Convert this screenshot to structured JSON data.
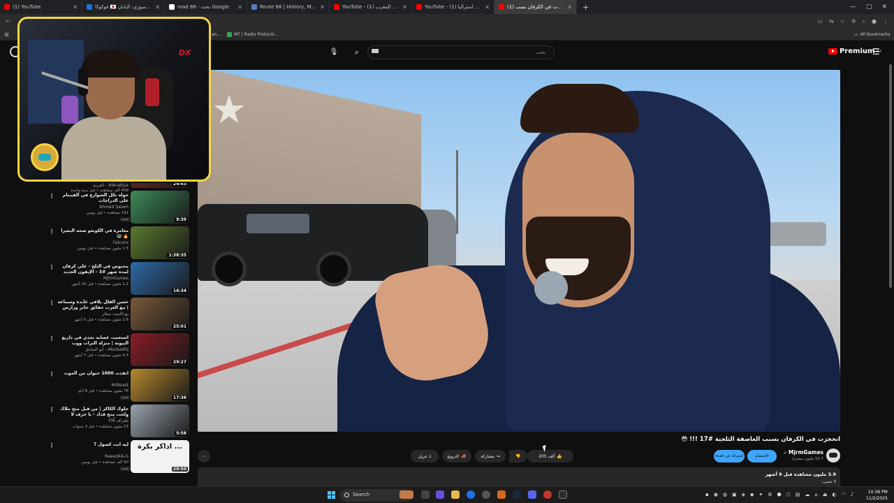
{
  "browser": {
    "tabs": [
      {
        "title": "(1) YouTube",
        "favicon_color": "#ff0000",
        "active": false
      },
      {
        "title": "فوكوكا 🇯🇵 إلى أوسوزي، اليابان",
        "favicon_color": "#1a73e8",
        "active": false
      },
      {
        "title": "road 66 - بحث Google",
        "favicon_color": "#ffffff",
        "active": false
      },
      {
        "title": "Route 66 | History, Map, Popula...",
        "favicon_color": "#5a7cc2",
        "active": false
      },
      {
        "title": "YouTube - (1) كرفان المغرب",
        "favicon_color": "#ff0000",
        "active": false
      },
      {
        "title": "YouTube - (1) كرفان في استراليا",
        "favicon_color": "#ff0000",
        "active": false
      },
      {
        "title": "(1) انحجزت في الكرفان بسب...",
        "favicon_color": "#ff0000",
        "active": true
      }
    ],
    "bookmarks": [
      {
        "label": "an..."
      },
      {
        "label": "MT | Radio Protocol..."
      },
      {
        "label": "All Bookmarks"
      }
    ]
  },
  "youtube": {
    "search_placeholder": "بحث",
    "premium_label": "Premium",
    "region": "SA",
    "menu_glyph": "☰"
  },
  "recommendations": [
    {
      "title": "",
      "channel": "AlArabiya - العربية",
      "meta": "458 ألف مشاهدة • قبل سنة واحدة",
      "duration": "24:43",
      "thumb_color": "#7b2a20",
      "partial": true
    },
    {
      "title": "جولة تكل الشوارع في الفيتنام على الدراجات",
      "channel": "Ahmed Salam",
      "meta": "141 مشاهدة • قبل يومين",
      "duration": "9:39",
      "thumb_color": "#3d8b5a",
      "new": "جديد"
    },
    {
      "title": "مغامرة في الكونغو صحة البشرا 🔥 😱",
      "channel": "Falcons",
      "meta": "1.5 مليون مشاهدة • قبل يومين",
      "duration": "1:38:35",
      "thumb_color": "#5a7a30"
    },
    {
      "title": "محبوس في الثلج - علي كرفان لمدة شهر #3 - الإيفون الجديد صحيح...",
      "channel": "MjrmGames",
      "meta": "1.2 مليون مشاهدة • قبل 10 أشهر",
      "duration": "16:34",
      "thumb_color": "#2f6aa8"
    },
    {
      "title": "حسن القلل يلاقي عابدة وسماعة | مع الغرب حقائق جابر وزارس الحزمة وقاء الدين",
      "channel": "بودكاست سقار",
      "meta": "1.6 مليون مشاهدة • قبل 5 أشهر",
      "duration": "25:01",
      "thumb_color": "#7a5a3a"
    },
    {
      "title": "استعمت عصابة نجدي في ذاريع البيوتة | منزلة التراث ووب",
      "channel": "Abulsadiq - أبو الصادق",
      "meta": "4.3 مليون مشاهدة • قبل 7 أشهر",
      "duration": "29:27",
      "thumb_color": "#8b1c26"
    },
    {
      "title": "أنقذت 1000 حيوان من الموت",
      "channel": "MrBeast",
      "meta": "76 مليون مشاهدة • قبل 8 أيام",
      "duration": "17:36",
      "thumb_color": "#b8892e",
      "new": "جديد"
    },
    {
      "title": "جلوك الكاكر | من قبل منح ملاك ولحت منح قداد - با حرف لا أعرف أين زجالها | ماجد...",
      "channel": "تلغراف FM",
      "meta": "15 مليون مشاهدة • قبل 3 سنوات",
      "duration": "5:58",
      "thumb_color": "#9aa4ad"
    },
    {
      "title": "ليه انت كسول ؟",
      "channel": "RaeedXA-G",
      "meta": "90 ألف مشاهدة • قبل يومين",
      "duration": "20:50",
      "thumb_color": "#f2f2f2",
      "thumb_text": "اذاكر بكرة ...",
      "new": "جديد"
    }
  ],
  "video": {
    "title": "انحجزت في الكرفان بسبب العاصفة الثلجية #17 !!! 😳",
    "channel": "MjrmGames",
    "subscribers": "10.7 مليون مشترك",
    "join_label": "الإنضمام",
    "subscribe_label": "اشتراك في القناة",
    "likes": "205 ألف",
    "share_label": "مشاركة",
    "promote_label": "الترويج",
    "download_label": "تنزيل",
    "views_date": "3.9 مليون مشاهدة  قبل 9 أشهر",
    "description_start": "لا تنسى:"
  },
  "taskbar": {
    "search_label": "Search",
    "time": "10:38 PM",
    "date": "11/2/2025"
  }
}
